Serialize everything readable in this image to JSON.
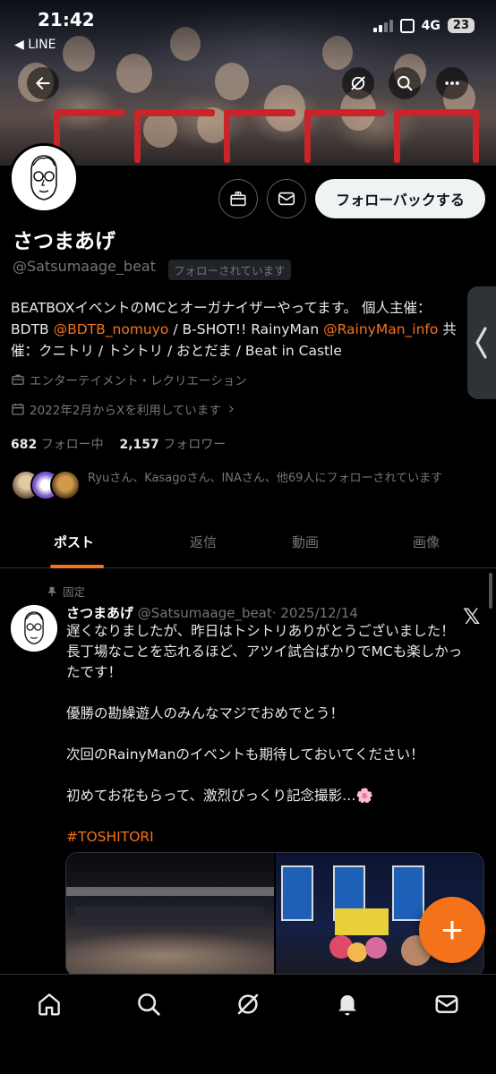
{
  "status": {
    "time": "21:42",
    "back_app": "◀ LINE",
    "network": "4G",
    "battery": "23"
  },
  "profile": {
    "display_name": "さつまあげ",
    "handle": "@Satsumaage_beat",
    "follows_you": "フォローされています",
    "follow_back": "フォローバックする",
    "bio": {
      "l1": "BEATBOXイベントのMCとオーガナイザーやってます。 個人主催：",
      "l2_pre": "BDTB ",
      "l2_link1": "@BDTB_nomuyo",
      "l2_mid": " / B-SHOT!! RainyMan ",
      "l2_link2": "@RainyMan_info",
      "l2_post": " 共",
      "l3": "催：クニトリ / トシトリ / おとだま / Beat in Castle"
    },
    "category": "エンターテイメント・レクリエーション",
    "joined": "2022年2月からXを利用しています",
    "following_count": "682",
    "following_label": "フォロー中",
    "followers_count": "2,157",
    "followers_label": "フォロワー",
    "followed_by": "Ryuさん、Kasagoさん、INAさん、他69人にフォローされています"
  },
  "tabs": [
    "ポスト",
    "返信",
    "動画",
    "画像"
  ],
  "post": {
    "pinned_label": "固定",
    "name": "さつまあげ",
    "handle": "@Satsumaage_beat",
    "dot": "·",
    "date": "2025/12/14",
    "lines": [
      "遅くなりましたが、昨日はトシトリありがとうございました！",
      "長丁場なことを忘れるほど、アツイ試合ばかりでMCも楽しかっ",
      "たです！",
      "",
      "優勝の勘繰遊人のみんなマジでおめでとう！",
      "",
      "次回のRainyManのイベントも期待しておいてください！",
      "",
      "初めてお花もらって、激烈びっくり記念撮影…🌸",
      "",
      "#TOSHITORI"
    ],
    "x_logo": "𝕏"
  },
  "fab_label": "+",
  "colors": {
    "accent": "#f4721a",
    "bg": "#000000",
    "muted": "#71767b"
  },
  "icons": [
    "back-arrow-icon",
    "grok-icon",
    "search-icon",
    "more-icon",
    "gift-icon",
    "mail-icon",
    "briefcase-icon",
    "calendar-icon",
    "pin-icon",
    "home-icon",
    "bell-icon"
  ]
}
